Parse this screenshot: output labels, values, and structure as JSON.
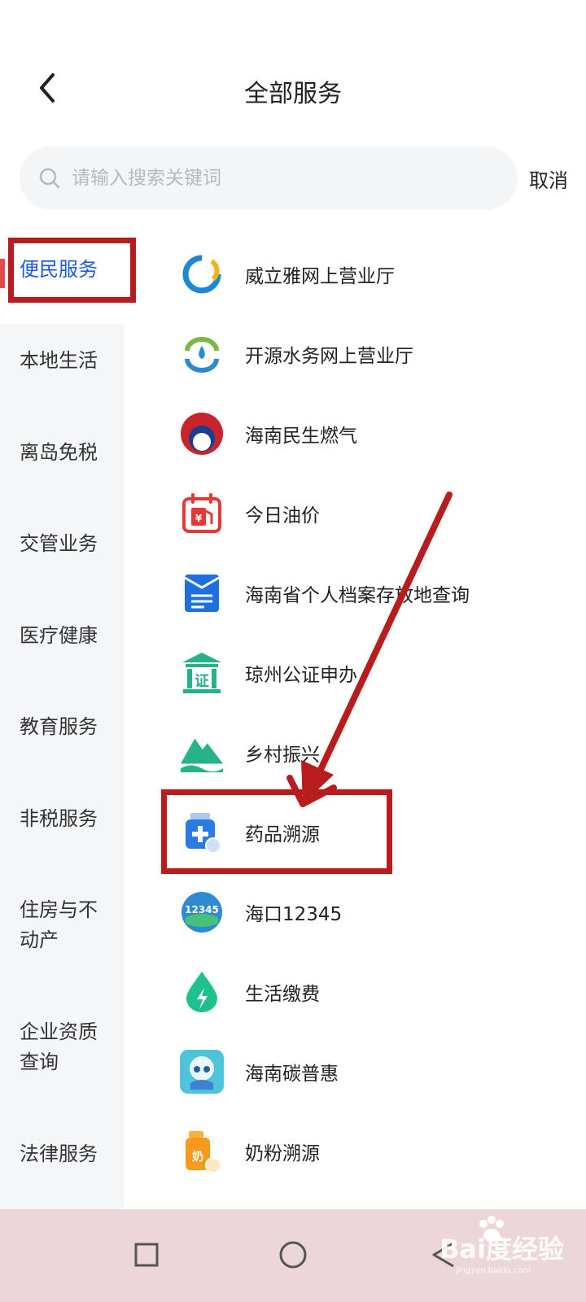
{
  "header": {
    "title": "全部服务"
  },
  "search": {
    "placeholder": "请输入搜索关键词",
    "cancel_label": "取消"
  },
  "sidebar": {
    "items": [
      {
        "label": "便民服务",
        "active": true
      },
      {
        "label": "本地生活"
      },
      {
        "label": "离岛免税"
      },
      {
        "label": "交管业务"
      },
      {
        "label": "医疗健康"
      },
      {
        "label": "教育服务"
      },
      {
        "label": "非税服务"
      },
      {
        "label": "住房与不动产"
      },
      {
        "label": "企业资质查询"
      },
      {
        "label": "法律服务"
      }
    ]
  },
  "services": [
    {
      "label": "威立雅网上营业厅",
      "icon": "veolia-icon"
    },
    {
      "label": "开源水务网上营业厅",
      "icon": "water-service-icon"
    },
    {
      "label": "海南民生燃气",
      "icon": "gas-icon"
    },
    {
      "label": "今日油价",
      "icon": "fuel-price-icon"
    },
    {
      "label": "海南省个人档案存放地查询",
      "icon": "archive-icon"
    },
    {
      "label": "琼州公证申办",
      "icon": "notary-icon"
    },
    {
      "label": "乡村振兴",
      "icon": "rural-revitalization-icon"
    },
    {
      "label": "药品溯源",
      "icon": "medicine-trace-icon"
    },
    {
      "label": "海口12345",
      "icon": "haikou-12345-icon"
    },
    {
      "label": "生活缴费",
      "icon": "utility-payment-icon"
    },
    {
      "label": "海南碳普惠",
      "icon": "carbon-mascot-icon"
    },
    {
      "label": "奶粉溯源",
      "icon": "milk-powder-trace-icon"
    }
  ],
  "icon_badges": {
    "notary": "证",
    "hotline": "12345",
    "milk": "奶"
  },
  "watermark": {
    "brand": "Bai度经验",
    "url": "jingyan.baidu.com"
  },
  "colors": {
    "accent": "#1e5bd8",
    "annotation": "#b81c1c",
    "sidebar_bg": "#f5f6f8"
  }
}
